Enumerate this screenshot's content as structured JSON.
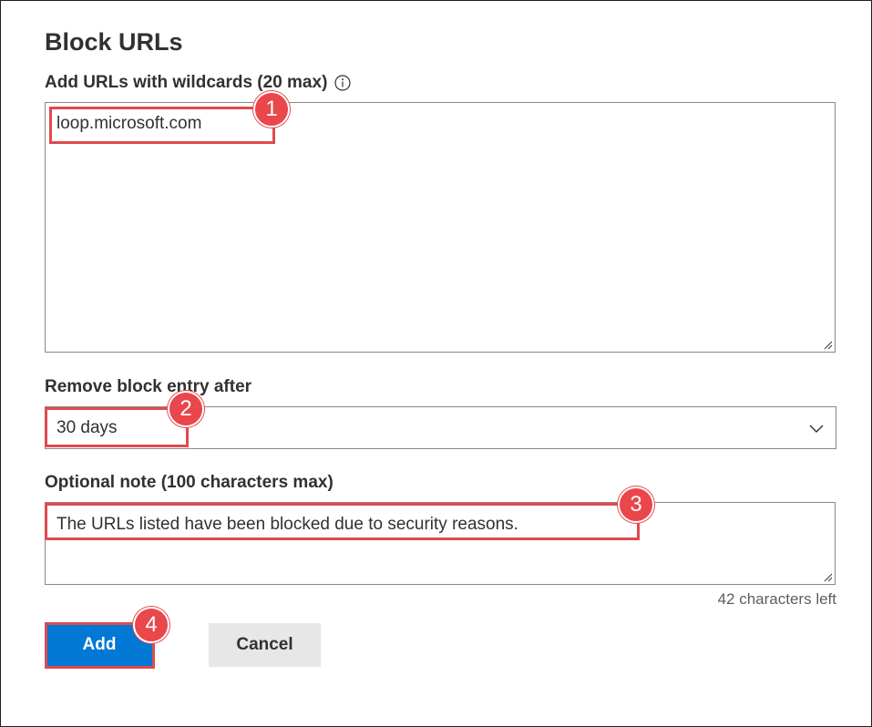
{
  "dialog": {
    "title": "Block URLs"
  },
  "urls_field": {
    "label": "Add URLs with wildcards (20 max)",
    "value": "loop.microsoft.com"
  },
  "expiry_field": {
    "label": "Remove block entry after",
    "selected": "30 days"
  },
  "note_field": {
    "label": "Optional note (100 characters max)",
    "value": "The URLs listed have been blocked due to security reasons.",
    "counter": "42 characters left"
  },
  "buttons": {
    "add": "Add",
    "cancel": "Cancel"
  },
  "callouts": [
    "1",
    "2",
    "3",
    "4"
  ],
  "colors": {
    "primary": "#0078d4",
    "callout": "#e9474b",
    "secondary_button": "#e7e7e7"
  }
}
